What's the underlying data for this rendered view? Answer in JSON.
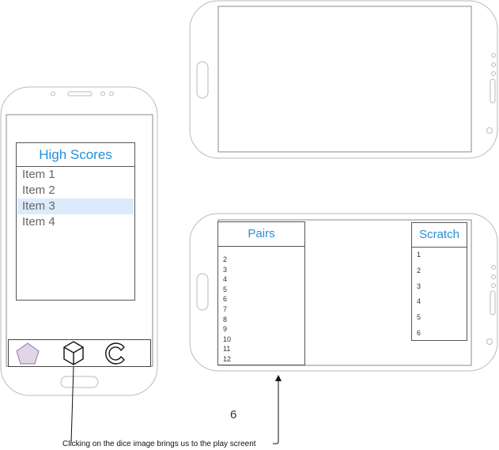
{
  "high_scores": {
    "title": "High Scores",
    "items": [
      "Item 1",
      "Item 2",
      "Item 3",
      "Item 4"
    ],
    "selected_index": 2
  },
  "toolbar": {
    "icons": [
      "pentagon-icon",
      "dice-cube-icon",
      "refresh-icon"
    ]
  },
  "pairs": {
    "title": "Pairs",
    "rows": [
      "2",
      "3",
      "4",
      "5",
      "6",
      "7",
      "8",
      "9",
      "10",
      "11",
      "12"
    ]
  },
  "scratch": {
    "title": "Scratch",
    "rows": [
      "1",
      "2",
      "3",
      "4",
      "5",
      "6"
    ]
  },
  "annotation": {
    "caption": "Clicking on the dice image brings us to the play screent",
    "number_label": "6"
  },
  "colors": {
    "title_blue": "#2490d8",
    "selected_row": "#dcebfb",
    "pentagon_fill": "#e1d5e7"
  }
}
